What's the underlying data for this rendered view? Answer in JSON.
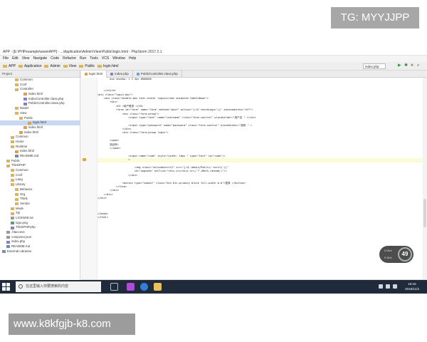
{
  "watermarks": {
    "top": "TG: MYYJJPP",
    "bottom": "www.k8kfgjb-k8.com"
  },
  "window": {
    "title": "APP - [E:\\PHPexample\\www\\APP] - ...\\Application\\Admin\\View\\Public\\login.html - PhpStorm 2017.2.1"
  },
  "menu": [
    "File",
    "Edit",
    "View",
    "Navigate",
    "Code",
    "Refactor",
    "Run",
    "Tools",
    "VCS",
    "Window",
    "Help"
  ],
  "navbar": {
    "crumbs": [
      "APP",
      "Application",
      "Admin",
      "View",
      "Public",
      "login.html"
    ],
    "run_config": "index.php"
  },
  "tabs": {
    "project_label": "Project",
    "items": [
      {
        "label": "login.html",
        "active": true,
        "color": "#e0a040"
      },
      {
        "label": "index.php",
        "active": false,
        "color": "#8a7fc6"
      },
      {
        "label": "PublicController.class.php",
        "active": false,
        "color": "#6aa0d8"
      }
    ]
  },
  "tree": [
    {
      "label": "Common",
      "indent": 3,
      "kind": "folder"
    },
    {
      "label": "Conf",
      "indent": 3,
      "kind": "folder"
    },
    {
      "label": "Controller",
      "indent": 3,
      "kind": "folder"
    },
    {
      "label": "index.html",
      "indent": 5,
      "kind": "html"
    },
    {
      "label": "IndexController.class.php",
      "indent": 5,
      "kind": "php"
    },
    {
      "label": "PublicController.class.php",
      "indent": 5,
      "kind": "php"
    },
    {
      "label": "Model",
      "indent": 3,
      "kind": "folder"
    },
    {
      "label": "View",
      "indent": 3,
      "kind": "folder"
    },
    {
      "label": "Public",
      "indent": 4,
      "kind": "folder"
    },
    {
      "label": "login.html",
      "indent": 6,
      "kind": "html",
      "selected": true
    },
    {
      "label": "index.html",
      "indent": 5,
      "kind": "html"
    },
    {
      "label": "index.html",
      "indent": 4,
      "kind": "html"
    },
    {
      "label": "Common",
      "indent": 2,
      "kind": "folder"
    },
    {
      "label": "Home",
      "indent": 2,
      "kind": "folder"
    },
    {
      "label": "Runtime",
      "indent": 2,
      "kind": "folder"
    },
    {
      "label": "index.html",
      "indent": 3,
      "kind": "html"
    },
    {
      "label": "README.md",
      "indent": 3,
      "kind": "md"
    },
    {
      "label": "Public",
      "indent": 1,
      "kind": "folder"
    },
    {
      "label": "ThinkPHP",
      "indent": 1,
      "kind": "folder"
    },
    {
      "label": "Common",
      "indent": 2,
      "kind": "folder"
    },
    {
      "label": "Conf",
      "indent": 2,
      "kind": "folder"
    },
    {
      "label": "Lang",
      "indent": 2,
      "kind": "folder"
    },
    {
      "label": "Library",
      "indent": 2,
      "kind": "folder"
    },
    {
      "label": "Behavior",
      "indent": 3,
      "kind": "folder"
    },
    {
      "label": "Org",
      "indent": 3,
      "kind": "folder"
    },
    {
      "label": "Think",
      "indent": 3,
      "kind": "folder"
    },
    {
      "label": "Vendor",
      "indent": 3,
      "kind": "folder"
    },
    {
      "label": "Mode",
      "indent": 2,
      "kind": "folder"
    },
    {
      "label": "Tpl",
      "indent": 2,
      "kind": "folder"
    },
    {
      "label": "LICENSE.txt",
      "indent": 2,
      "kind": "txt"
    },
    {
      "label": "logo.png",
      "indent": 2,
      "kind": "img"
    },
    {
      "label": "ThinkPHP.php",
      "indent": 2,
      "kind": "php"
    },
    {
      "label": ".htaccess",
      "indent": 1,
      "kind": "txt"
    },
    {
      "label": "composer.json",
      "indent": 1,
      "kind": "txt"
    },
    {
      "label": "index.php",
      "indent": 1,
      "kind": "php"
    },
    {
      "label": "README.md",
      "indent": 1,
      "kind": "md"
    },
    {
      "label": "External Libraries",
      "indent": 0,
      "kind": "lib"
    }
  ],
  "code": [
    "        box-shadow: 1 3 4px #000000",
    "",
    "",
    "    </style>",
    "<div class=\"login_box\">",
    "    <div class=\"middle-box text-center loginscreen animated fadeInDown\">",
    "        <div>",
    "            <h3 >用户登录 </h3>",
    "            <form id=\"form\" name=\"form\" method=\"post\" action=\"{:U('checkLogin')}\" autocomplete=\"off\">",
    "                <div class=\"form-group\">",
    "                    <input type=\"text\" name=\"username\" class=\"form-control\" placeholder=\"用户名 \" ></br>",
    "",
    "                    <input type=\"password\" name=\"password\" class=\"form-control\" placeholder=\"密码 \" >",
    "                </div>",
    "                <div class=\"form-group login\">",
    "",
    "        <span>",
    "        验证码:",
    "        </span>",
    "",
    "                    <input name=\"code\" style=\"width: 10px \" type=\"text\" id=\"code\"/>",
    "                    <",
    "",
    "                        <img class=\"valcodeverify\" src=\"{:U('Admin/Public/ verify')}\"",
    "                        id=\"imgcode\" onClick=\"this.src=this.src+'?'+Math.random()\"/>",
    "                    </div>",
    "",
    "                <button type=\"submit\" class=\"btn btn-primary block full-width m-b\">登录 </button>",
    "            </form>",
    "        </div>",
    "    </div>",
    "</div>",
    "",
    "",
    "",
    "</body>",
    "</html>"
  ],
  "breadcrumb": "html > body.gray-bg > div.login_box > div.middle-box.text-center.loginscreen.animated.fadeInDown > div > form#form > div.form-group.login > #",
  "status": {
    "message": "Composer: Composer configuration file found: Initialize Composer settings? Do not ask again. (25 minutes ago)",
    "position": "40:24",
    "line_ending": "CRLF",
    "encoding": "UTF-8"
  },
  "bubble": {
    "number": "49",
    "btn1": "0.0k/s",
    "btn2": "0.0k/s"
  },
  "taskbar": {
    "search_placeholder": "在这里输入你要搜索的内容",
    "time": "16:15",
    "date": "2018/11/3"
  }
}
